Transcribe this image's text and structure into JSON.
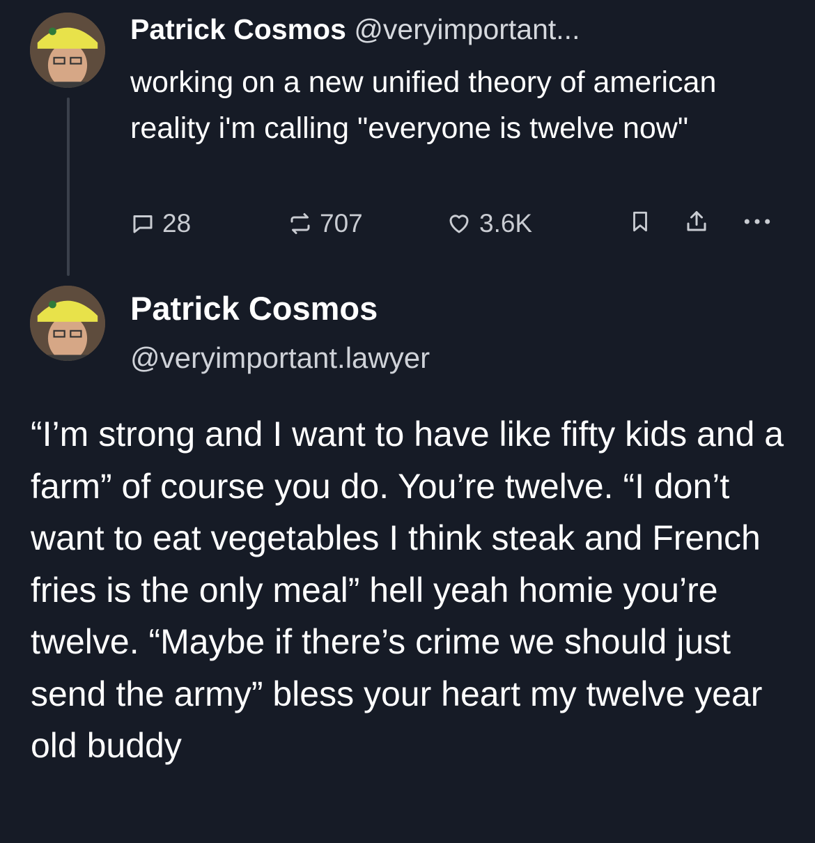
{
  "colors": {
    "background": "#161b26",
    "text": "#ffffff",
    "muted": "#c9ccd2",
    "thread_line": "#3a404b"
  },
  "tweet1": {
    "name": "Patrick Cosmos",
    "handle": "@veryimportant...",
    "text": "working on a new unified theory of american reality i'm calling \"everyone is twelve now\"",
    "replies": "28",
    "reposts": "707",
    "likes": "3.6K",
    "icons": [
      "reply-icon",
      "repost-icon",
      "like-icon",
      "bookmark-icon",
      "share-icon",
      "more-icon"
    ]
  },
  "tweet2": {
    "name": "Patrick Cosmos",
    "handle": "@veryimportant.lawyer",
    "text": "“I’m strong and I want to have like fifty kids and a farm” of course you do. You’re twelve. “I don’t want to eat vegetables I think steak and French fries is the only meal” hell yeah homie you’re twelve. “Maybe if there’s crime we should just send the army” bless your heart my twelve year old buddy"
  }
}
